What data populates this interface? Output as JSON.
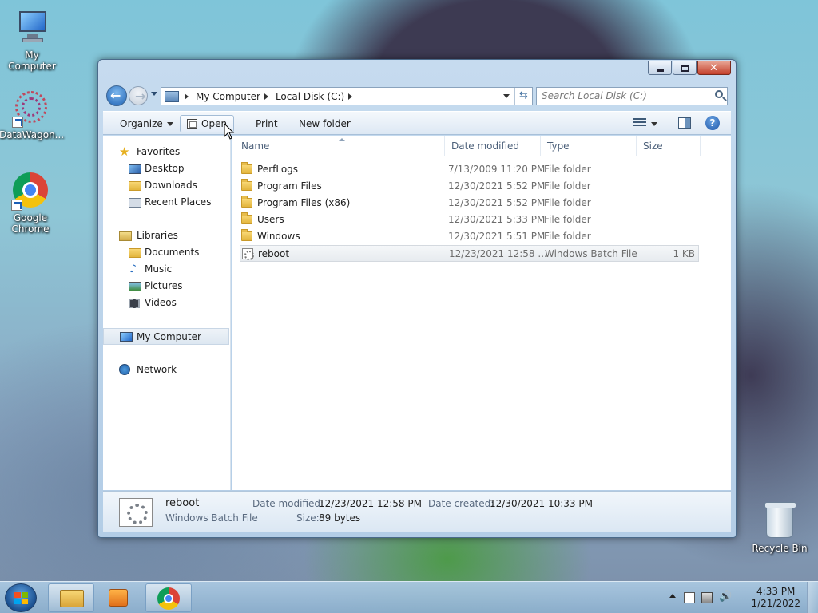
{
  "desktop": {
    "icons": [
      {
        "label": "My Computer"
      },
      {
        "label": "DataWagon..."
      },
      {
        "label": "Google Chrome"
      }
    ],
    "recycle_bin": "Recycle Bin"
  },
  "window": {
    "address": {
      "crumbs": [
        "My Computer",
        "Local Disk (C:)"
      ]
    },
    "search": {
      "placeholder": "Search Local Disk (C:)"
    },
    "toolbar": {
      "organize": "Organize",
      "open": "Open",
      "print": "Print",
      "new_folder": "New folder",
      "help": "?"
    },
    "nav": {
      "favorites": "Favorites",
      "desktop": "Desktop",
      "downloads": "Downloads",
      "recent_places": "Recent Places",
      "libraries": "Libraries",
      "documents": "Documents",
      "music": "Music",
      "pictures": "Pictures",
      "videos": "Videos",
      "my_computer": "My Computer",
      "network": "Network"
    },
    "columns": {
      "name": "Name",
      "date_modified": "Date modified",
      "type": "Type",
      "size": "Size"
    },
    "files": [
      {
        "name": "PerfLogs",
        "date": "7/13/2009 11:20 PM",
        "type": "File folder",
        "size": ""
      },
      {
        "name": "Program Files",
        "date": "12/30/2021 5:52 PM",
        "type": "File folder",
        "size": ""
      },
      {
        "name": "Program Files (x86)",
        "date": "12/30/2021 5:52 PM",
        "type": "File folder",
        "size": ""
      },
      {
        "name": "Users",
        "date": "12/30/2021 5:33 PM",
        "type": "File folder",
        "size": ""
      },
      {
        "name": "Windows",
        "date": "12/30/2021 5:51 PM",
        "type": "File folder",
        "size": ""
      },
      {
        "name": "reboot",
        "date": "12/23/2021 12:58 ...",
        "type": "Windows Batch File",
        "size": "1 KB"
      }
    ],
    "details": {
      "name": "reboot",
      "kind": "Windows Batch File",
      "date_modified_label": "Date modified:",
      "date_modified": "12/23/2021 12:58 PM",
      "date_created_label": "Date created:",
      "date_created": "12/30/2021 10:33 PM",
      "size_label": "Size:",
      "size": "89 bytes"
    }
  },
  "taskbar": {
    "time": "4:33 PM",
    "date": "1/21/2022"
  },
  "colors": {
    "accent": "#1f62b4",
    "folder": "#e3b53d",
    "selection": "#e7ebef"
  }
}
